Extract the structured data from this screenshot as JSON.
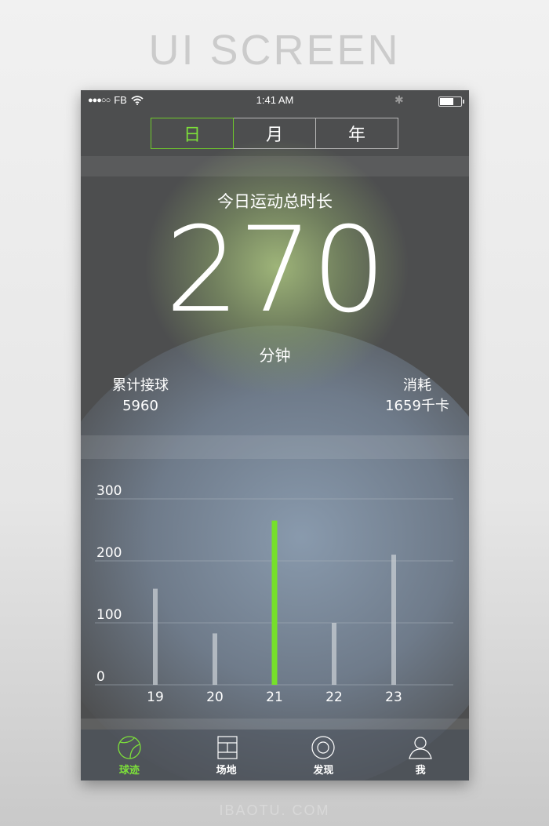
{
  "page": {
    "headline": "UI SCREEN",
    "footer_brand": "IBAOTU. COM"
  },
  "status_bar": {
    "signal": "●●●○○",
    "carrier": "FB",
    "wifi_icon": "wifi-icon",
    "time": "1:41 AM",
    "bluetooth_icon": "bluetooth-icon",
    "battery_icon": "battery-icon"
  },
  "segmented": {
    "options": [
      "日",
      "月",
      "年"
    ],
    "selected": "日"
  },
  "summary": {
    "title": "今日运动总时长",
    "value": "270",
    "unit": "分钟",
    "left_label": "累计接球",
    "left_value": "5960",
    "right_label": "消耗",
    "right_value": "1659千卡"
  },
  "colors": {
    "accent": "#76e02a",
    "bar": "#c8cdd3",
    "grid": "#a7b0ba"
  },
  "chart_data": {
    "type": "bar",
    "title": "",
    "xlabel": "",
    "ylabel": "",
    "categories": [
      "19",
      "20",
      "21",
      "22",
      "23"
    ],
    "values": [
      155,
      83,
      265,
      100,
      210
    ],
    "highlight_index": 2,
    "ylim": [
      0,
      300
    ],
    "yticks": [
      0,
      100,
      200,
      300
    ],
    "grid": true,
    "legend": "none"
  },
  "tabbar": {
    "items": [
      {
        "label": "球迹",
        "icon": "tennis-ball-icon",
        "active": true
      },
      {
        "label": "场地",
        "icon": "court-icon",
        "active": false
      },
      {
        "label": "发现",
        "icon": "discover-icon",
        "active": false
      },
      {
        "label": "我",
        "icon": "user-icon",
        "active": false
      }
    ]
  }
}
